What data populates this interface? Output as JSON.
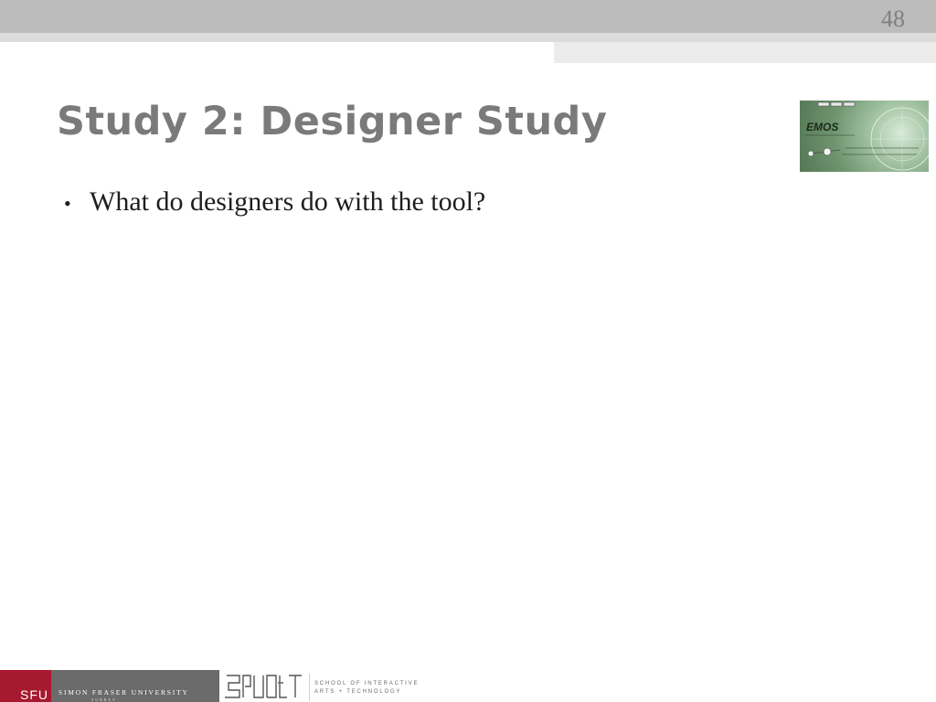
{
  "slide": {
    "number": "48",
    "title": "Study 2: Designer Study",
    "bullets": [
      "What do designers do with the tool?"
    ]
  },
  "thumbnail": {
    "label": "EMOS",
    "icon": "emos-screenshot-image"
  },
  "footer": {
    "sfu_abbrev": "SFU",
    "sfu_name": "SIMON FRASER UNIVERSITY",
    "sfu_campus": "SURREY",
    "siat_line1": "SCHOOL OF INTERACTIVE",
    "siat_line2": "ARTS + TECHNOLOGY",
    "logo_icon": "siat-logo"
  },
  "colors": {
    "sfu_red": "#a6192e",
    "title_gray": "#7a7a7a",
    "band_gray": "#bcbcbc"
  }
}
